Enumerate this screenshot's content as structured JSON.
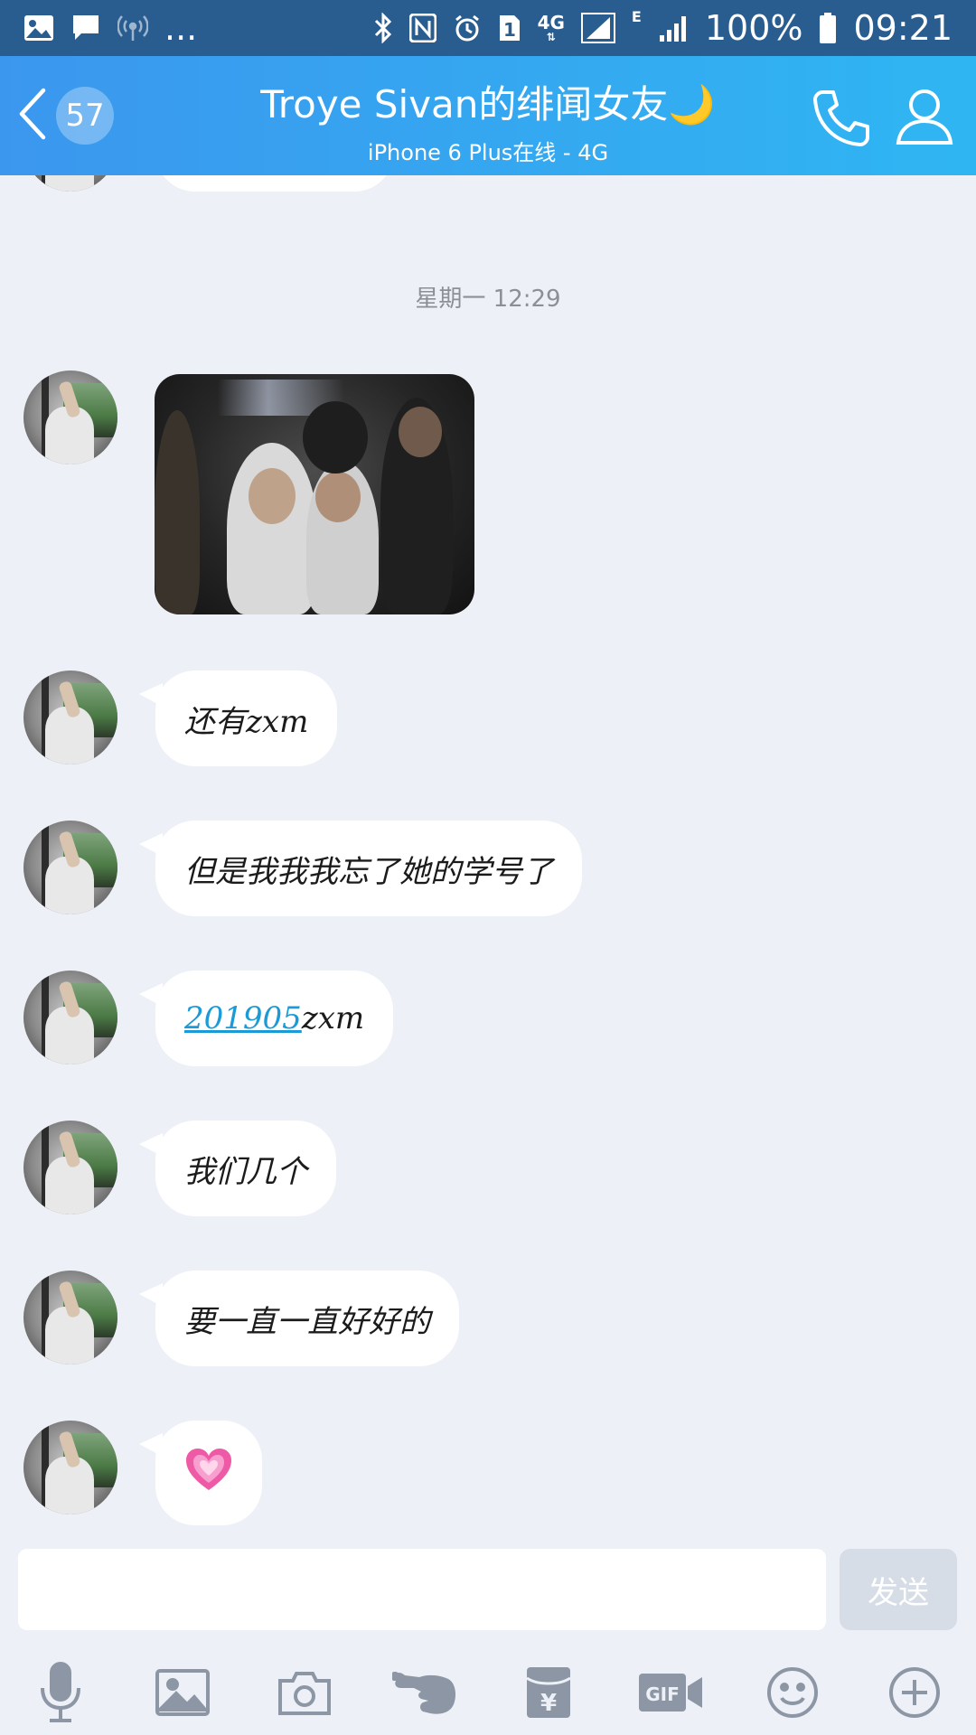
{
  "status_bar": {
    "battery": "100%",
    "time": "09:21",
    "more": "...",
    "network": "4G",
    "network2": "E"
  },
  "header": {
    "back_count": "57",
    "title": "Troye Sivan的绯闻女友🌙",
    "subtitle": "iPhone 6 Plus在线 - 4G"
  },
  "chat": {
    "timestamp": "星期一 12:29",
    "messages": [
      {
        "type": "image"
      },
      {
        "type": "text",
        "text": "还有zxm"
      },
      {
        "type": "text",
        "text": "但是我我我忘了她的学号了"
      },
      {
        "type": "link",
        "link": "201905",
        "suffix": "zxm"
      },
      {
        "type": "text",
        "text": "我们几个"
      },
      {
        "type": "text",
        "text": "要一直一直好好的"
      },
      {
        "type": "text",
        "text": "💗"
      }
    ]
  },
  "composer": {
    "input_value": "",
    "send_label": "发送"
  },
  "toolbar": {
    "items": [
      "microphone-icon",
      "image-icon",
      "camera-icon",
      "poke-icon",
      "red-packet-icon",
      "gif-icon",
      "emoji-icon",
      "plus-icon"
    ]
  },
  "colors": {
    "header_start": "#3b97ee",
    "header_end": "#2fb6f2",
    "chat_bg": "#edf1f7",
    "link": "#1a9ad6"
  }
}
